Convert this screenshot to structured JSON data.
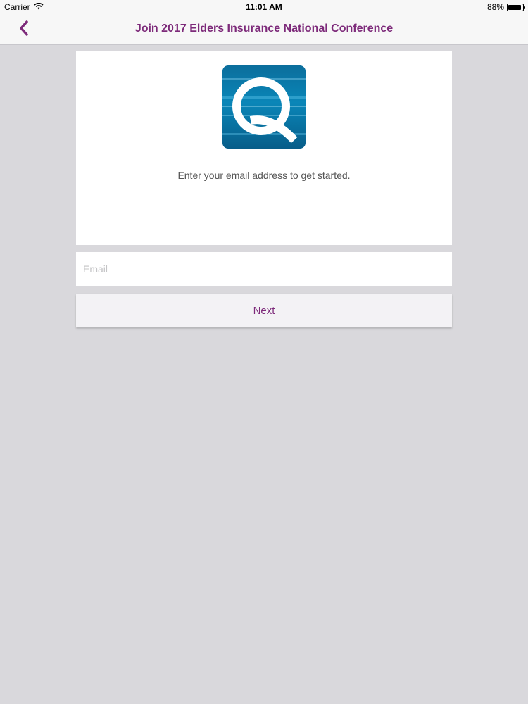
{
  "status_bar": {
    "carrier": "Carrier",
    "time": "11:01 AM",
    "battery_percent": "88%",
    "battery_level": 0.88,
    "wifi_icon": "wifi-icon"
  },
  "nav": {
    "back_icon": "chevron-left-icon",
    "title": "Join 2017 Elders Insurance National Conference"
  },
  "card": {
    "logo_icon": "q-app-logo",
    "intro_text": "Enter your email address to get started."
  },
  "form": {
    "email_value": "",
    "email_placeholder": "Email",
    "next_label": "Next"
  },
  "colors": {
    "accent": "#7d2a7a",
    "background": "#d9d8dc",
    "logo_blue": "#0a86b8"
  }
}
